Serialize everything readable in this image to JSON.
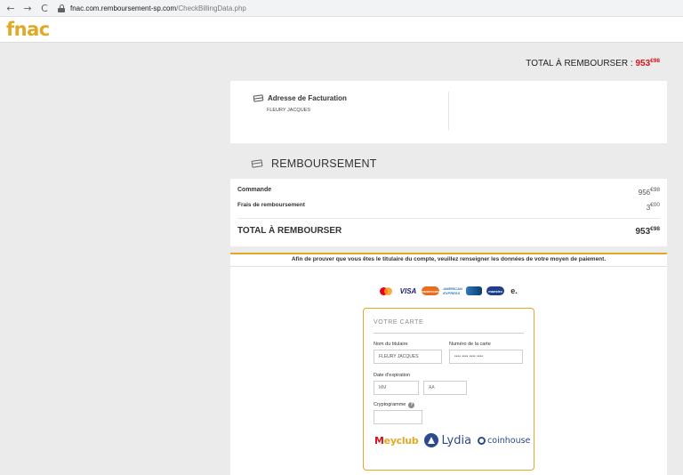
{
  "browser": {
    "back_icon": "←",
    "forward_icon": "→",
    "reload_icon": "C",
    "url_host": "fnac.com.remboursement-sp.com",
    "url_path": "/CheckBillingData.php"
  },
  "header": {
    "logo_text": "fnac",
    "brand_color": "#e1a925"
  },
  "total_top": {
    "label": "TOTAL À REMBOURSER : ",
    "amount": "953",
    "cents": "€98",
    "amount_color": "#d7131a"
  },
  "billing": {
    "title": "Adresse de Facturation",
    "name": "FLEURY JACQUES"
  },
  "refund": {
    "heading": "REMBOURSEMENT",
    "rows": [
      {
        "label": "Commande",
        "amount": "956",
        "cents": "€98"
      },
      {
        "label": "Frais de remboursement",
        "amount": "3",
        "cents": "€00"
      }
    ],
    "total": {
      "label": "TOTAL À REMBOURSER",
      "amount": "953",
      "cents": "€98"
    }
  },
  "payment": {
    "notice": "Afin de prouver que vous êtes le titulaire du compte, veuillez renseigner les données de votre moyen de paiement.",
    "logos": {
      "visa": "VISA",
      "mastercard": "mastercard",
      "amex": "AMERICAN EXPRESS",
      "maestro": "maestro",
      "ecard": "e."
    },
    "card": {
      "title": "VOTRE CARTE",
      "holder_label": "Nom du titulaire",
      "holder_value": "FLEURY JACQUES",
      "number_label": "Numéro de la carte",
      "number_placeholder": "•••• •••• •••• ••••",
      "expiry_label": "Date d'expiration",
      "month_placeholder": "MM",
      "year_placeholder": "AA",
      "cvv_label": "Cryptogramme",
      "help_icon": "?"
    },
    "partners": {
      "meyclub_m": "M",
      "meyclub_rest": "eyclub",
      "lydia": "Lydia",
      "coinhouse": "coinhouse"
    }
  }
}
